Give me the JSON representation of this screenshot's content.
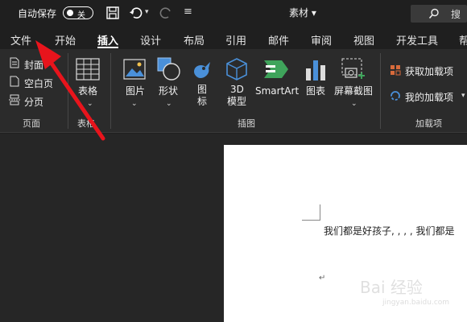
{
  "titlebar": {
    "autosave_label": "自动保存",
    "autosave_state": "关",
    "doc_title": "素材",
    "doc_title_caret": "▾",
    "search_label": "搜"
  },
  "tabs": [
    "文件",
    "开始",
    "插入",
    "设计",
    "布局",
    "引用",
    "邮件",
    "审阅",
    "视图",
    "开发工具",
    "帮"
  ],
  "active_tab": "插入",
  "ribbon": {
    "pages_group": {
      "items": [
        "封面",
        "空白页",
        "分页"
      ],
      "label": "页面"
    },
    "table_group": {
      "button": "表格",
      "label": "表格"
    },
    "illustrations_group": {
      "buttons": {
        "picture": "图片",
        "shapes": "形状",
        "icons_line1": "图",
        "icons_line2": "标",
        "model_line1": "3D",
        "model_line2": "模型",
        "smartart": "SmartArt",
        "chart": "图表",
        "screenshot": "屏幕截图"
      },
      "label": "插图"
    },
    "addins_group": {
      "get_addins": "获取加载项",
      "my_addins": "我的加载项",
      "label": "加载项"
    }
  },
  "document": {
    "text": "我们都是好孩子, , , ,   我们都是",
    "paragraph_mark": "↵",
    "watermark_text": "Bai 经验",
    "watermark_url": "jingyan.baidu.com"
  },
  "colors": {
    "title_bg": "#1f1f1f",
    "ribbon_bg": "#2b2b2b",
    "accent_blue": "#4a90d9",
    "addin_orange": "#d86a3b",
    "arrow_red": "#e8141c"
  }
}
